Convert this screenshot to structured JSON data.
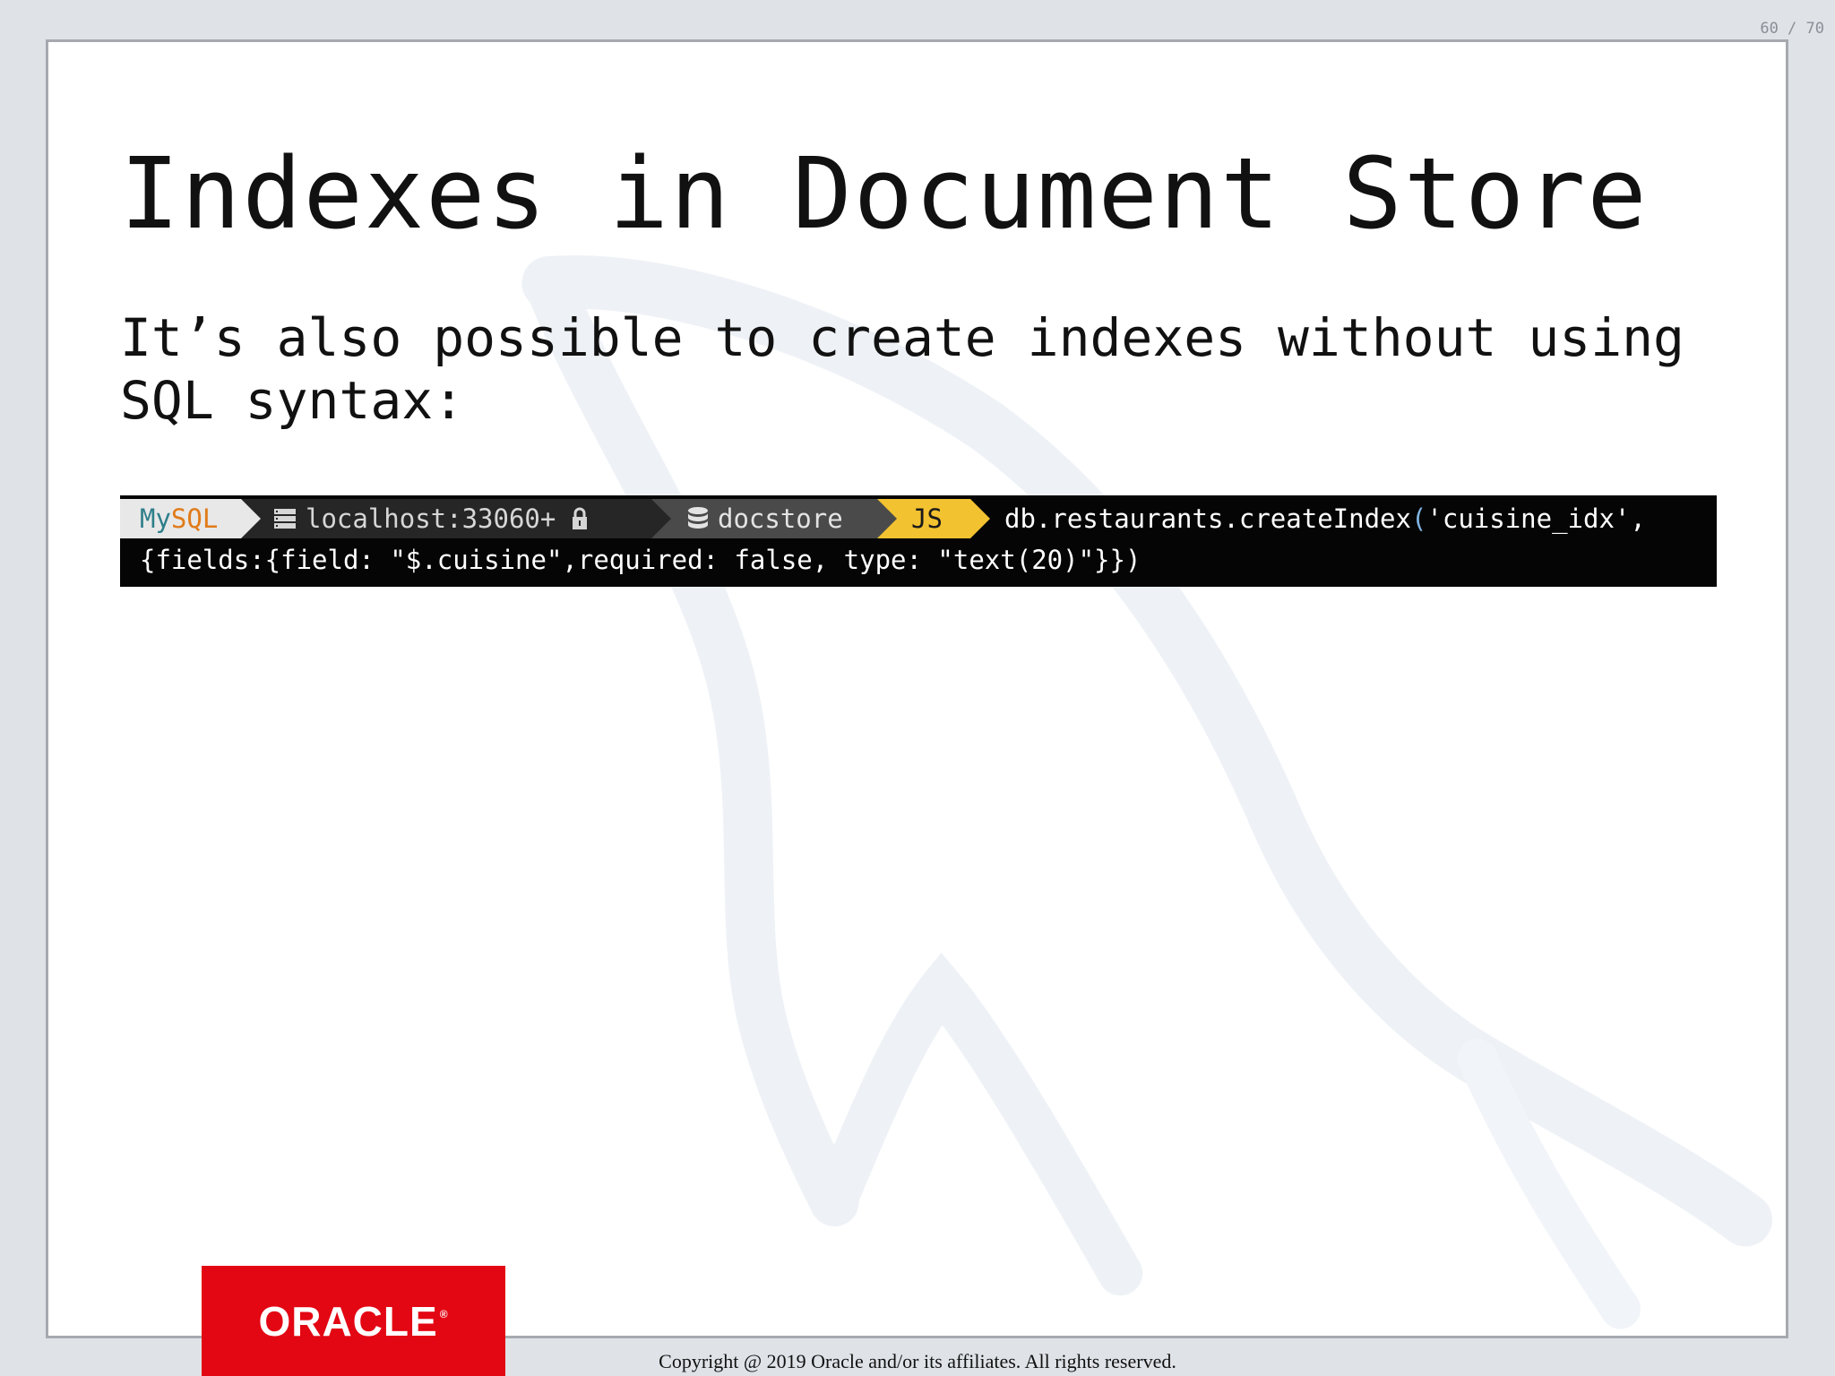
{
  "viewer": {
    "page_counter": "60 / 70"
  },
  "slide": {
    "title": "Indexes in Document Store",
    "subtitle": "It’s also possible to create indexes without using SQL syntax:"
  },
  "terminal": {
    "prompt": {
      "mysql_my": "My",
      "mysql_sql": "SQL",
      "host": "localhost:33060+",
      "schema": "docstore",
      "mode": "JS"
    },
    "command_line1_prefix": "db.restaurants.createIndex",
    "command_line1_paren": "(",
    "command_line1_suffix": "'cuisine_idx',",
    "command_line2": "{fields:{field: \"$.cuisine\",required: false, type: \"text(20)\"}})"
  },
  "footer": {
    "logo_text": "ORACLE",
    "logo_mark": "®",
    "copyright": "Copyright @ 2019 Oracle and/or its affiliates. All rights reserved."
  },
  "colors": {
    "oracle_red": "#e30613",
    "prompt_js": "#f2c230",
    "prompt_mysql_my": "#2e7f8a",
    "prompt_mysql_sql": "#e07b1a"
  }
}
